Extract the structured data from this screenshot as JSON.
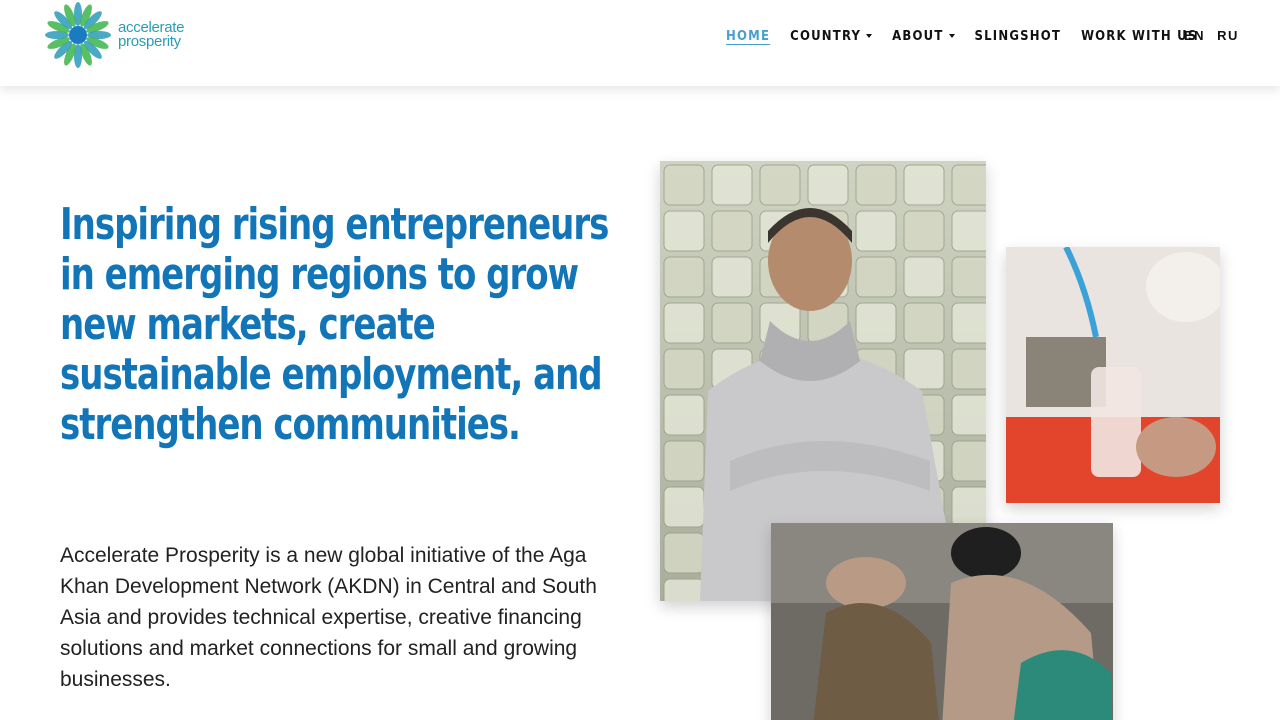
{
  "brand": {
    "logo_line1": "accelerate",
    "logo_line2": "prosperity",
    "logo_color": "#2a9bb8",
    "logo_accent": "#3cb44b"
  },
  "nav": {
    "items": [
      {
        "label": "HOME",
        "active": true
      },
      {
        "label": "COUNTRY",
        "dropdown": true
      },
      {
        "label": "ABOUT",
        "dropdown": true
      },
      {
        "label": "SLINGSHOT"
      },
      {
        "label": "WORK WITH US"
      }
    ],
    "active_color": "#4a9fcf"
  },
  "languages": [
    "EN",
    "RU"
  ],
  "hero": {
    "headline": "Inspiring rising entrepreneurs in emerging regions to grow new markets, create sustainable employment, and strengthen communities.",
    "headline_color": "#1275b8",
    "intro": "Accelerate Prosperity is a new global initiative of the Aga Khan Development Network (AKDN) in Central and South Asia and provides technical expertise, creative financing solutions and market connections for small and growing businesses."
  },
  "images": {
    "main_photo": "photo-icon",
    "side_photo": "photo-icon",
    "bottom_photo": "photo-icon"
  }
}
